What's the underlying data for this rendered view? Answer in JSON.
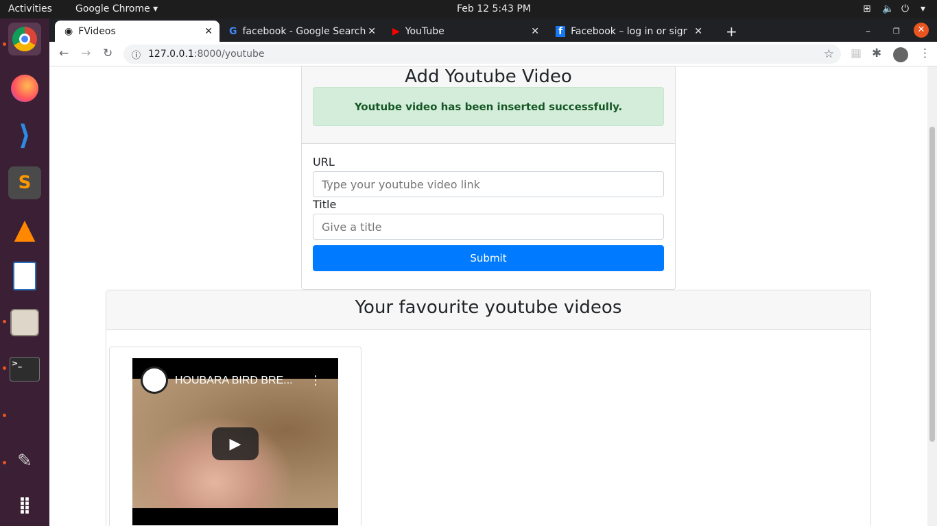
{
  "system": {
    "activities": "Activities",
    "app_menu": "Google Chrome ▾",
    "datetime": "Feb 12  5:43 PM"
  },
  "tabs": [
    {
      "title": "FVideos",
      "active": true
    },
    {
      "title": "facebook - Google Search"
    },
    {
      "title": "YouTube"
    },
    {
      "title": "Facebook – log in or sign u"
    }
  ],
  "address": {
    "host": "127.0.0.1",
    "rest": ":8000/youtube"
  },
  "form": {
    "title": "Add Youtube Video",
    "alert": "Youtube video has been inserted successfully.",
    "url_label": "URL",
    "url_placeholder": "Type your youtube video link",
    "title_label": "Title",
    "title_placeholder": "Give a title",
    "submit": "Submit"
  },
  "favourites": {
    "title": "Your favourite youtube videos",
    "videos": [
      {
        "title": "HOUBARA BIRD BRE..."
      }
    ]
  }
}
